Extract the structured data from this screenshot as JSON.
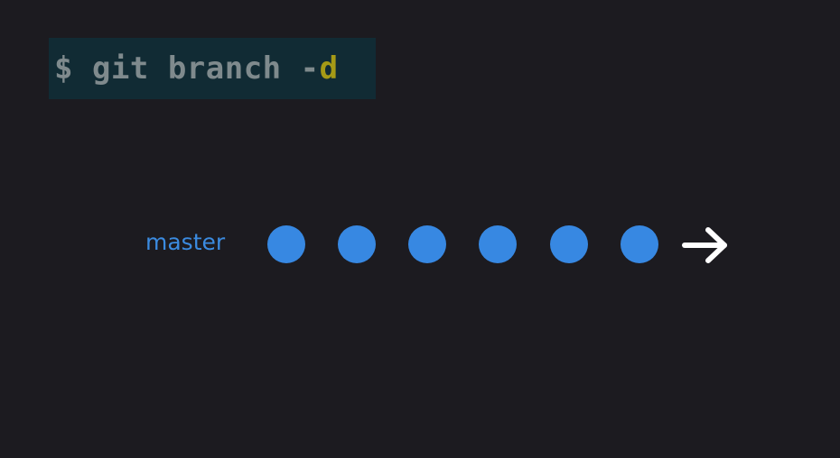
{
  "terminal": {
    "command_base": "$ git branch -",
    "command_flag": "d"
  },
  "diagram": {
    "branch_label": "master",
    "commit_count": 6,
    "commit_color": "#3788e2",
    "label_color": "#3b8be0",
    "arrow_icon": "right-arrow-icon",
    "arrow_color": "#ffffff"
  },
  "colors": {
    "background": "#1c1b20",
    "terminal_background": "#112b34",
    "command_text": "#7f8a8d",
    "flag_text": "#a59a16"
  }
}
